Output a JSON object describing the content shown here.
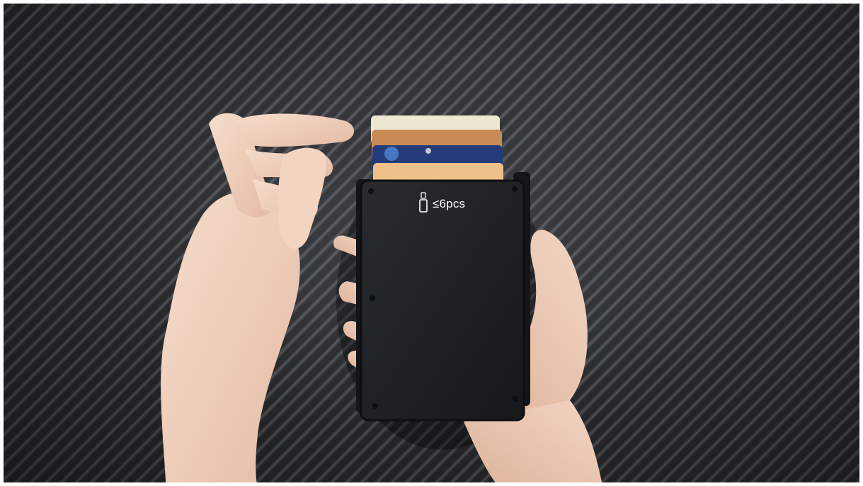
{
  "product": {
    "capacity_label": "≤6pcs",
    "icon": "card-insert-icon"
  },
  "colors": {
    "background": "#2b2c2f",
    "wallet": "#1f2023",
    "skin": "#f1d2bf",
    "label_text": "#ffffff"
  }
}
